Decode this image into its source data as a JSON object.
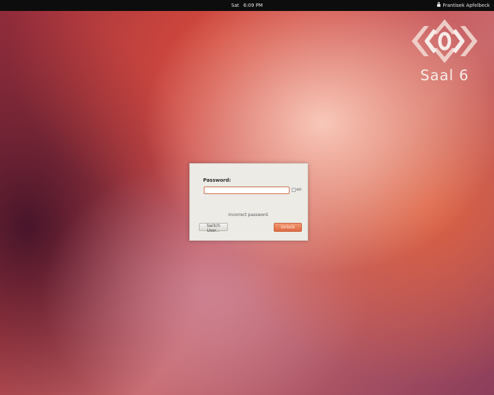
{
  "top_panel": {
    "clock_day": "Sat",
    "clock_time": "6:09 PM",
    "user_name": "Frantisek Apfelbeck"
  },
  "logo": {
    "text": "Saal 6"
  },
  "unlock_dialog": {
    "password_label": "Password:",
    "password_value": "",
    "keyboard_layout": "en",
    "message": "Incorrect password.",
    "switch_user_label": "Switch User...",
    "unlock_label": "Unlock"
  },
  "colors": {
    "panel_background": "#0d0d0d",
    "accent": "#de6a42",
    "dialog_background": "#ecebe6"
  }
}
